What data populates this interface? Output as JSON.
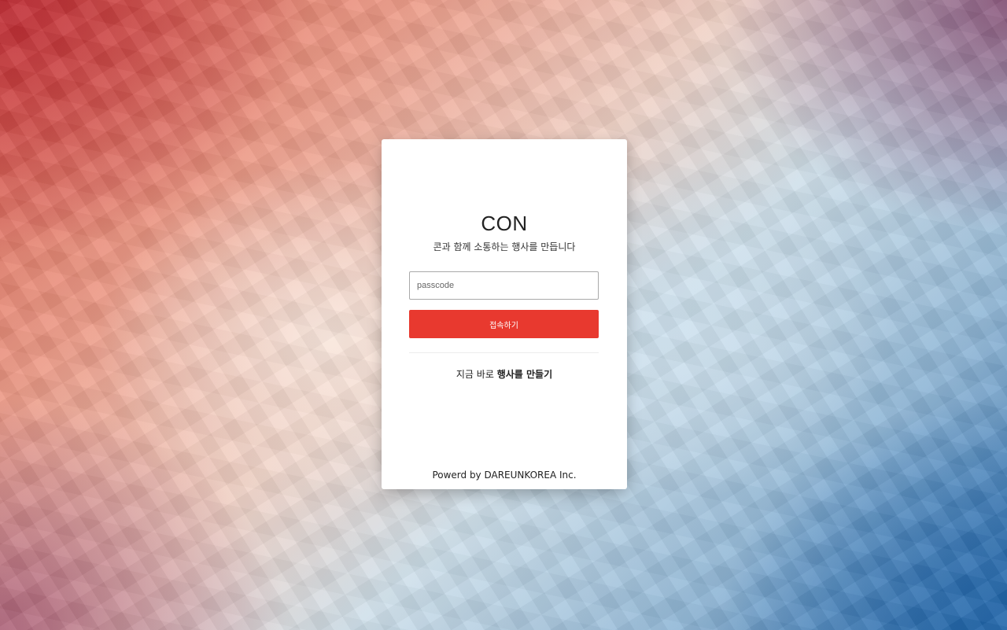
{
  "colors": {
    "accent": "#e8392f",
    "card_bg": "#ffffff",
    "text": "#222222"
  },
  "login_card": {
    "title": "CON",
    "subtitle": "콘과 함께 소통하는 행사를 만듭니다",
    "passcode_input": {
      "value": "",
      "placeholder": "passcode"
    },
    "connect_button_label": "접속하기",
    "create_event": {
      "prefix": "지금 바로",
      "emphasis": "행사를 만들기"
    },
    "footer": "Powerd by DAREUNKOREA Inc."
  }
}
